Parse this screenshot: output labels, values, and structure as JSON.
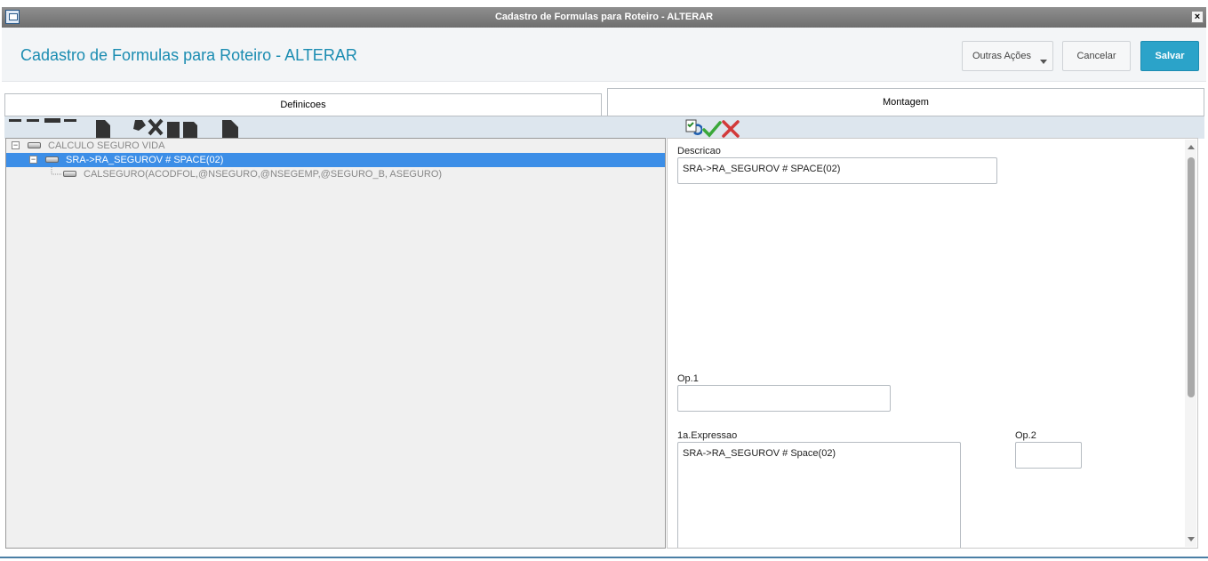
{
  "window": {
    "title": "Cadastro de Formulas para Roteiro - ALTERAR",
    "close_glyph": "×"
  },
  "header": {
    "page_title": "Cadastro de Formulas para Roteiro - ALTERAR",
    "buttons": {
      "outras": "Outras Ações",
      "cancelar": "Cancelar",
      "salvar": "Salvar"
    }
  },
  "tabs": {
    "definicoes": "Definicoes",
    "montagem": "Montagem"
  },
  "tree": {
    "nodes": [
      {
        "label": "CALCULO SEGURO VIDA",
        "expander": "−"
      },
      {
        "label": "SRA->RA_SEGUROV # SPACE(02)",
        "expander": "−"
      },
      {
        "label": "CALSEGURO(ACODFOL,@NSEGURO,@NSEGEMP,@SEGURO_B, ASEGURO)"
      }
    ]
  },
  "form": {
    "descricao_label": "Descricao",
    "descricao_value": "SRA->RA_SEGUROV # SPACE(02)",
    "op1_label": "Op.1",
    "op1_value": "",
    "expressao_label": "1a.Expressao",
    "expressao_value": "SRA->RA_SEGUROV # Space(02)",
    "op2_label": "Op.2",
    "op2_value": ""
  },
  "colors": {
    "accent": "#2ba3c9",
    "title_text": "#1a8cb1",
    "selection": "#3c8ee7",
    "confirm": "#3aa83a",
    "cancel": "#d23a3a"
  },
  "icons": [
    "window-app-icon",
    "close-icon",
    "checklist-icon",
    "check-icon",
    "x-icon",
    "scroll-up-icon",
    "scroll-down-icon"
  ]
}
